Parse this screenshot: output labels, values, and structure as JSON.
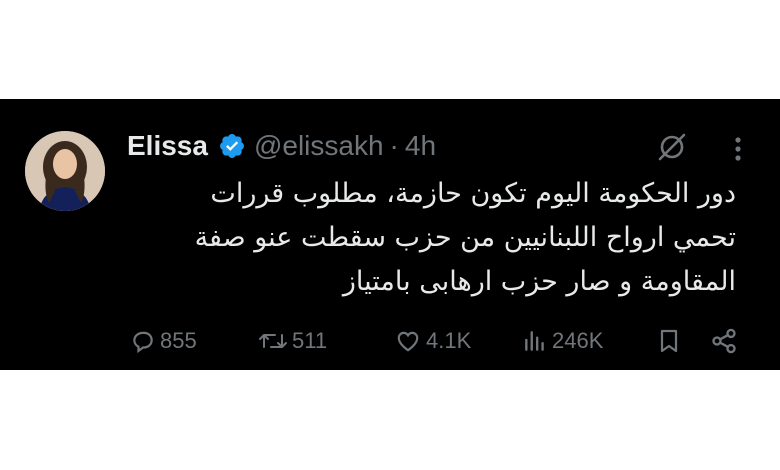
{
  "tweet": {
    "author_name": "Elissa",
    "verified": true,
    "handle": "@elissakh",
    "separator": "·",
    "time": "4h",
    "text": "دور الحكومة اليوم تكون حازمة، مطلوب قررات تحمي ارواح اللبنانيين من حزب سقطت عنو صفة المقاومة و صار حزب ارهابى بامتياز",
    "stats": {
      "replies": "855",
      "retweets": "511",
      "likes": "4.1K",
      "views": "246K"
    },
    "accent_color": "#1d9bf0",
    "icons": [
      "grok-icon",
      "more-icon",
      "reply-icon",
      "retweet-icon",
      "like-icon",
      "views-icon",
      "bookmark-icon",
      "share-icon"
    ]
  }
}
